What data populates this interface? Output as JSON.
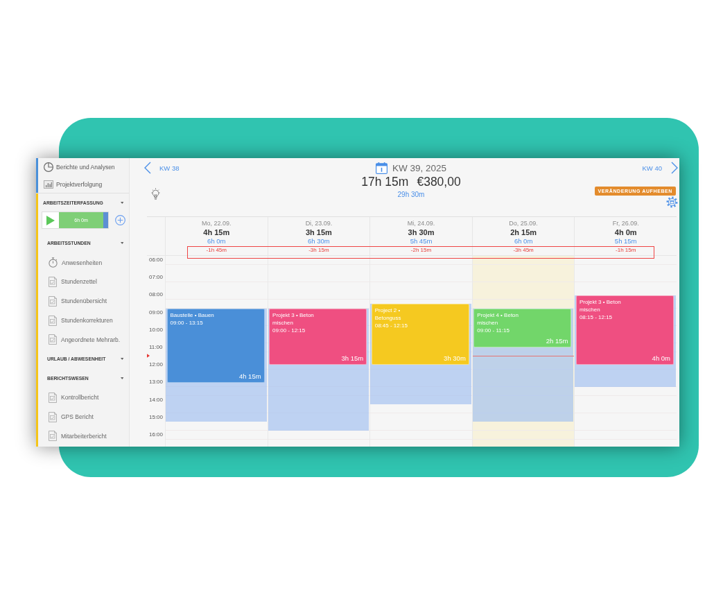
{
  "sidebar": {
    "groups": [
      {
        "color": "#4a90d9",
        "items": [
          {
            "kind": "pie",
            "label": "Berichte und Analysen"
          },
          {
            "kind": "bars",
            "label": "Projektverfolgung"
          }
        ]
      },
      {
        "color": "#f5c518",
        "title": "ARBEITSZEITERFASSUNG",
        "timer": {
          "label": "6h 0m"
        },
        "sections": [
          {
            "title": "ARBEITSSTUNDEN",
            "items": [
              {
                "kind": "stopwatch",
                "label": "Anwesenheiten"
              },
              {
                "kind": "document",
                "label": "Stundenzettel"
              },
              {
                "kind": "document",
                "label": "Stundenübersicht"
              },
              {
                "kind": "document",
                "label": "Stundenkorrekturen"
              },
              {
                "kind": "document",
                "label": "Angeordnete Mehrarb."
              }
            ]
          },
          {
            "title": "URLAUB / ABWESENHEIT"
          },
          {
            "title": "BERICHTSWESEN",
            "items": [
              {
                "kind": "document",
                "label": "Kontrollbericht"
              },
              {
                "kind": "document",
                "label": "GPS Bericht"
              },
              {
                "kind": "document",
                "label": "Mitarbeiterbericht"
              }
            ]
          }
        ]
      }
    ]
  },
  "header": {
    "prev_week": "KW 38",
    "week": "KW 39, 2025",
    "total": "17h 15m",
    "amount": "€380,00",
    "target": "29h 30m",
    "next_week": "KW 40",
    "reset_button": "VERÄNDERUNG AUFHEBEN"
  },
  "calendar": {
    "hours": [
      "06:00",
      "07:00",
      "08:00",
      "09:00",
      "10:00",
      "11:00",
      "12:00",
      "13:00",
      "14:00",
      "15:00",
      "16:00"
    ],
    "now_marker": {
      "level": 0.52
    },
    "highlight_diffs": true,
    "days": [
      {
        "date": "Mo, 22.09.",
        "total": "4h 15m",
        "target": "6h 0m",
        "diff": "-1h 45m",
        "today": false,
        "events": [
          {
            "title": "Baustelle • Bauen",
            "time": "09:00 - 13:15",
            "duration": "4h 15m",
            "color": "#4a8fd8"
          }
        ]
      },
      {
        "date": "Di, 23.09.",
        "total": "3h 15m",
        "target": "6h 30m",
        "diff": "-3h 15m",
        "today": false,
        "events": [
          {
            "title": "Projekt 3 • Beton mischen",
            "time": "09:00 - 12:15",
            "duration": "3h 15m",
            "color": "#ef4f81"
          }
        ]
      },
      {
        "date": "Mi, 24.09.",
        "total": "3h 30m",
        "target": "5h 45m",
        "diff": "-2h 15m",
        "today": false,
        "events": [
          {
            "title": "Project 2 • Betonguss",
            "time": "08:45 - 12:15",
            "duration": "3h 30m",
            "color": "#f5c920"
          }
        ]
      },
      {
        "date": "Do, 25.09.",
        "total": "2h 15m",
        "target": "6h 0m",
        "diff": "-3h 45m",
        "today": true,
        "events": [
          {
            "title": "Projekt 4 • Beton mischen",
            "time": "09:00 - 11:15",
            "duration": "2h 15m",
            "color": "#72d66a"
          }
        ]
      },
      {
        "date": "Fr, 26.09.",
        "total": "4h 0m",
        "target": "5h 15m",
        "diff": "-1h 15m",
        "today": false,
        "events": [
          {
            "title": "Projekt 3 • Beton mischen",
            "time": "08:15 - 12:15",
            "duration": "4h 0m",
            "color": "#ef4f81"
          }
        ]
      }
    ]
  }
}
